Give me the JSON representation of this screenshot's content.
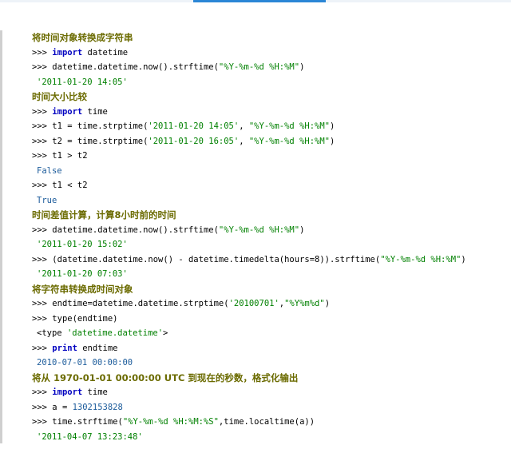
{
  "lines": [
    {
      "kind": "heading",
      "text": "将时间对象转换成字符串"
    },
    {
      "kind": "code",
      "parts": [
        {
          "c": "prompt",
          "t": ">>> "
        },
        {
          "c": "kw",
          "t": "import"
        },
        {
          "c": "plain",
          "t": " datetime"
        }
      ]
    },
    {
      "kind": "code",
      "parts": [
        {
          "c": "prompt",
          "t": ">>> "
        },
        {
          "c": "plain",
          "t": "datetime.datetime.now().strftime("
        },
        {
          "c": "str",
          "t": "\"%Y-%m-%d %H:%M\""
        },
        {
          "c": "plain",
          "t": ")"
        }
      ]
    },
    {
      "kind": "output",
      "parts": [
        {
          "c": "outstr",
          "t": "'2011-01-20 14:05'"
        }
      ]
    },
    {
      "kind": "heading",
      "text": "时间大小比较"
    },
    {
      "kind": "code",
      "parts": [
        {
          "c": "prompt",
          "t": ">>> "
        },
        {
          "c": "kw",
          "t": "import"
        },
        {
          "c": "plain",
          "t": " time"
        }
      ]
    },
    {
      "kind": "code",
      "parts": [
        {
          "c": "prompt",
          "t": ">>> "
        },
        {
          "c": "plain",
          "t": "t1 = time.strptime("
        },
        {
          "c": "str",
          "t": "'2011-01-20 14:05'"
        },
        {
          "c": "plain",
          "t": ", "
        },
        {
          "c": "str",
          "t": "\"%Y-%m-%d %H:%M\""
        },
        {
          "c": "plain",
          "t": ")"
        }
      ]
    },
    {
      "kind": "code",
      "parts": [
        {
          "c": "prompt",
          "t": ">>> "
        },
        {
          "c": "plain",
          "t": "t2 = time.strptime("
        },
        {
          "c": "str",
          "t": "'2011-01-20 16:05'"
        },
        {
          "c": "plain",
          "t": ", "
        },
        {
          "c": "str",
          "t": "\"%Y-%m-%d %H:%M\""
        },
        {
          "c": "plain",
          "t": ")"
        }
      ]
    },
    {
      "kind": "code",
      "parts": [
        {
          "c": "prompt",
          "t": ">>> "
        },
        {
          "c": "plain",
          "t": "t1 > t2"
        }
      ]
    },
    {
      "kind": "output",
      "parts": [
        {
          "c": "out",
          "t": "False"
        }
      ]
    },
    {
      "kind": "code",
      "parts": [
        {
          "c": "prompt",
          "t": ">>> "
        },
        {
          "c": "plain",
          "t": "t1 < t2"
        }
      ]
    },
    {
      "kind": "output",
      "parts": [
        {
          "c": "out",
          "t": "True"
        }
      ]
    },
    {
      "kind": "heading",
      "text": "时间差值计算，计算8小时前的时间"
    },
    {
      "kind": "code",
      "parts": [
        {
          "c": "prompt",
          "t": ">>> "
        },
        {
          "c": "plain",
          "t": "datetime.datetime.now().strftime("
        },
        {
          "c": "str",
          "t": "\"%Y-%m-%d %H:%M\""
        },
        {
          "c": "plain",
          "t": ")"
        }
      ]
    },
    {
      "kind": "output",
      "parts": [
        {
          "c": "outstr",
          "t": "'2011-01-20 15:02'"
        }
      ]
    },
    {
      "kind": "code",
      "parts": [
        {
          "c": "prompt",
          "t": ">>> "
        },
        {
          "c": "plain",
          "t": "(datetime.datetime.now() - datetime.timedelta(hours=8)).strftime("
        },
        {
          "c": "str",
          "t": "\"%Y-%m-%d %H:%M\""
        },
        {
          "c": "plain",
          "t": ")"
        }
      ]
    },
    {
      "kind": "output",
      "parts": [
        {
          "c": "outstr",
          "t": "'2011-01-20 07:03'"
        }
      ]
    },
    {
      "kind": "heading",
      "text": "将字符串转换成时间对象"
    },
    {
      "kind": "code",
      "parts": [
        {
          "c": "prompt",
          "t": ">>> "
        },
        {
          "c": "plain",
          "t": "endtime=datetime.datetime.strptime("
        },
        {
          "c": "str",
          "t": "'20100701'"
        },
        {
          "c": "plain",
          "t": ","
        },
        {
          "c": "str",
          "t": "\"%Y%m%d\""
        },
        {
          "c": "plain",
          "t": ")"
        }
      ]
    },
    {
      "kind": "code",
      "parts": [
        {
          "c": "prompt",
          "t": ">>> "
        },
        {
          "c": "plain",
          "t": "type(endtime)"
        }
      ]
    },
    {
      "kind": "output",
      "parts": [
        {
          "c": "plain",
          "t": "<type "
        },
        {
          "c": "str",
          "t": "'datetime.datetime'"
        },
        {
          "c": "plain",
          "t": ">"
        }
      ]
    },
    {
      "kind": "code",
      "parts": [
        {
          "c": "prompt",
          "t": ">>> "
        },
        {
          "c": "kw",
          "t": "print"
        },
        {
          "c": "plain",
          "t": " endtime"
        }
      ]
    },
    {
      "kind": "output",
      "parts": [
        {
          "c": "out",
          "t": "2010-07-01 00:00:00"
        }
      ]
    },
    {
      "kind": "heading",
      "text": "将从 1970-01-01 00:00:00 UTC 到现在的秒数，格式化输出"
    },
    {
      "kind": "code",
      "parts": [
        {
          "c": "prompt",
          "t": ">>> "
        },
        {
          "c": "kw",
          "t": "import"
        },
        {
          "c": "plain",
          "t": " time"
        }
      ]
    },
    {
      "kind": "code",
      "parts": [
        {
          "c": "prompt",
          "t": ">>> "
        },
        {
          "c": "plain",
          "t": "a = "
        },
        {
          "c": "out",
          "t": "1302153828"
        }
      ]
    },
    {
      "kind": "code",
      "parts": [
        {
          "c": "prompt",
          "t": ">>> "
        },
        {
          "c": "plain",
          "t": "time.strftime("
        },
        {
          "c": "str",
          "t": "\"%Y-%m-%d %H:%M:%S\""
        },
        {
          "c": "plain",
          "t": ",time.localtime(a))"
        }
      ]
    },
    {
      "kind": "output",
      "parts": [
        {
          "c": "outstr",
          "t": "'2011-04-07 13:23:48'"
        }
      ]
    }
  ]
}
